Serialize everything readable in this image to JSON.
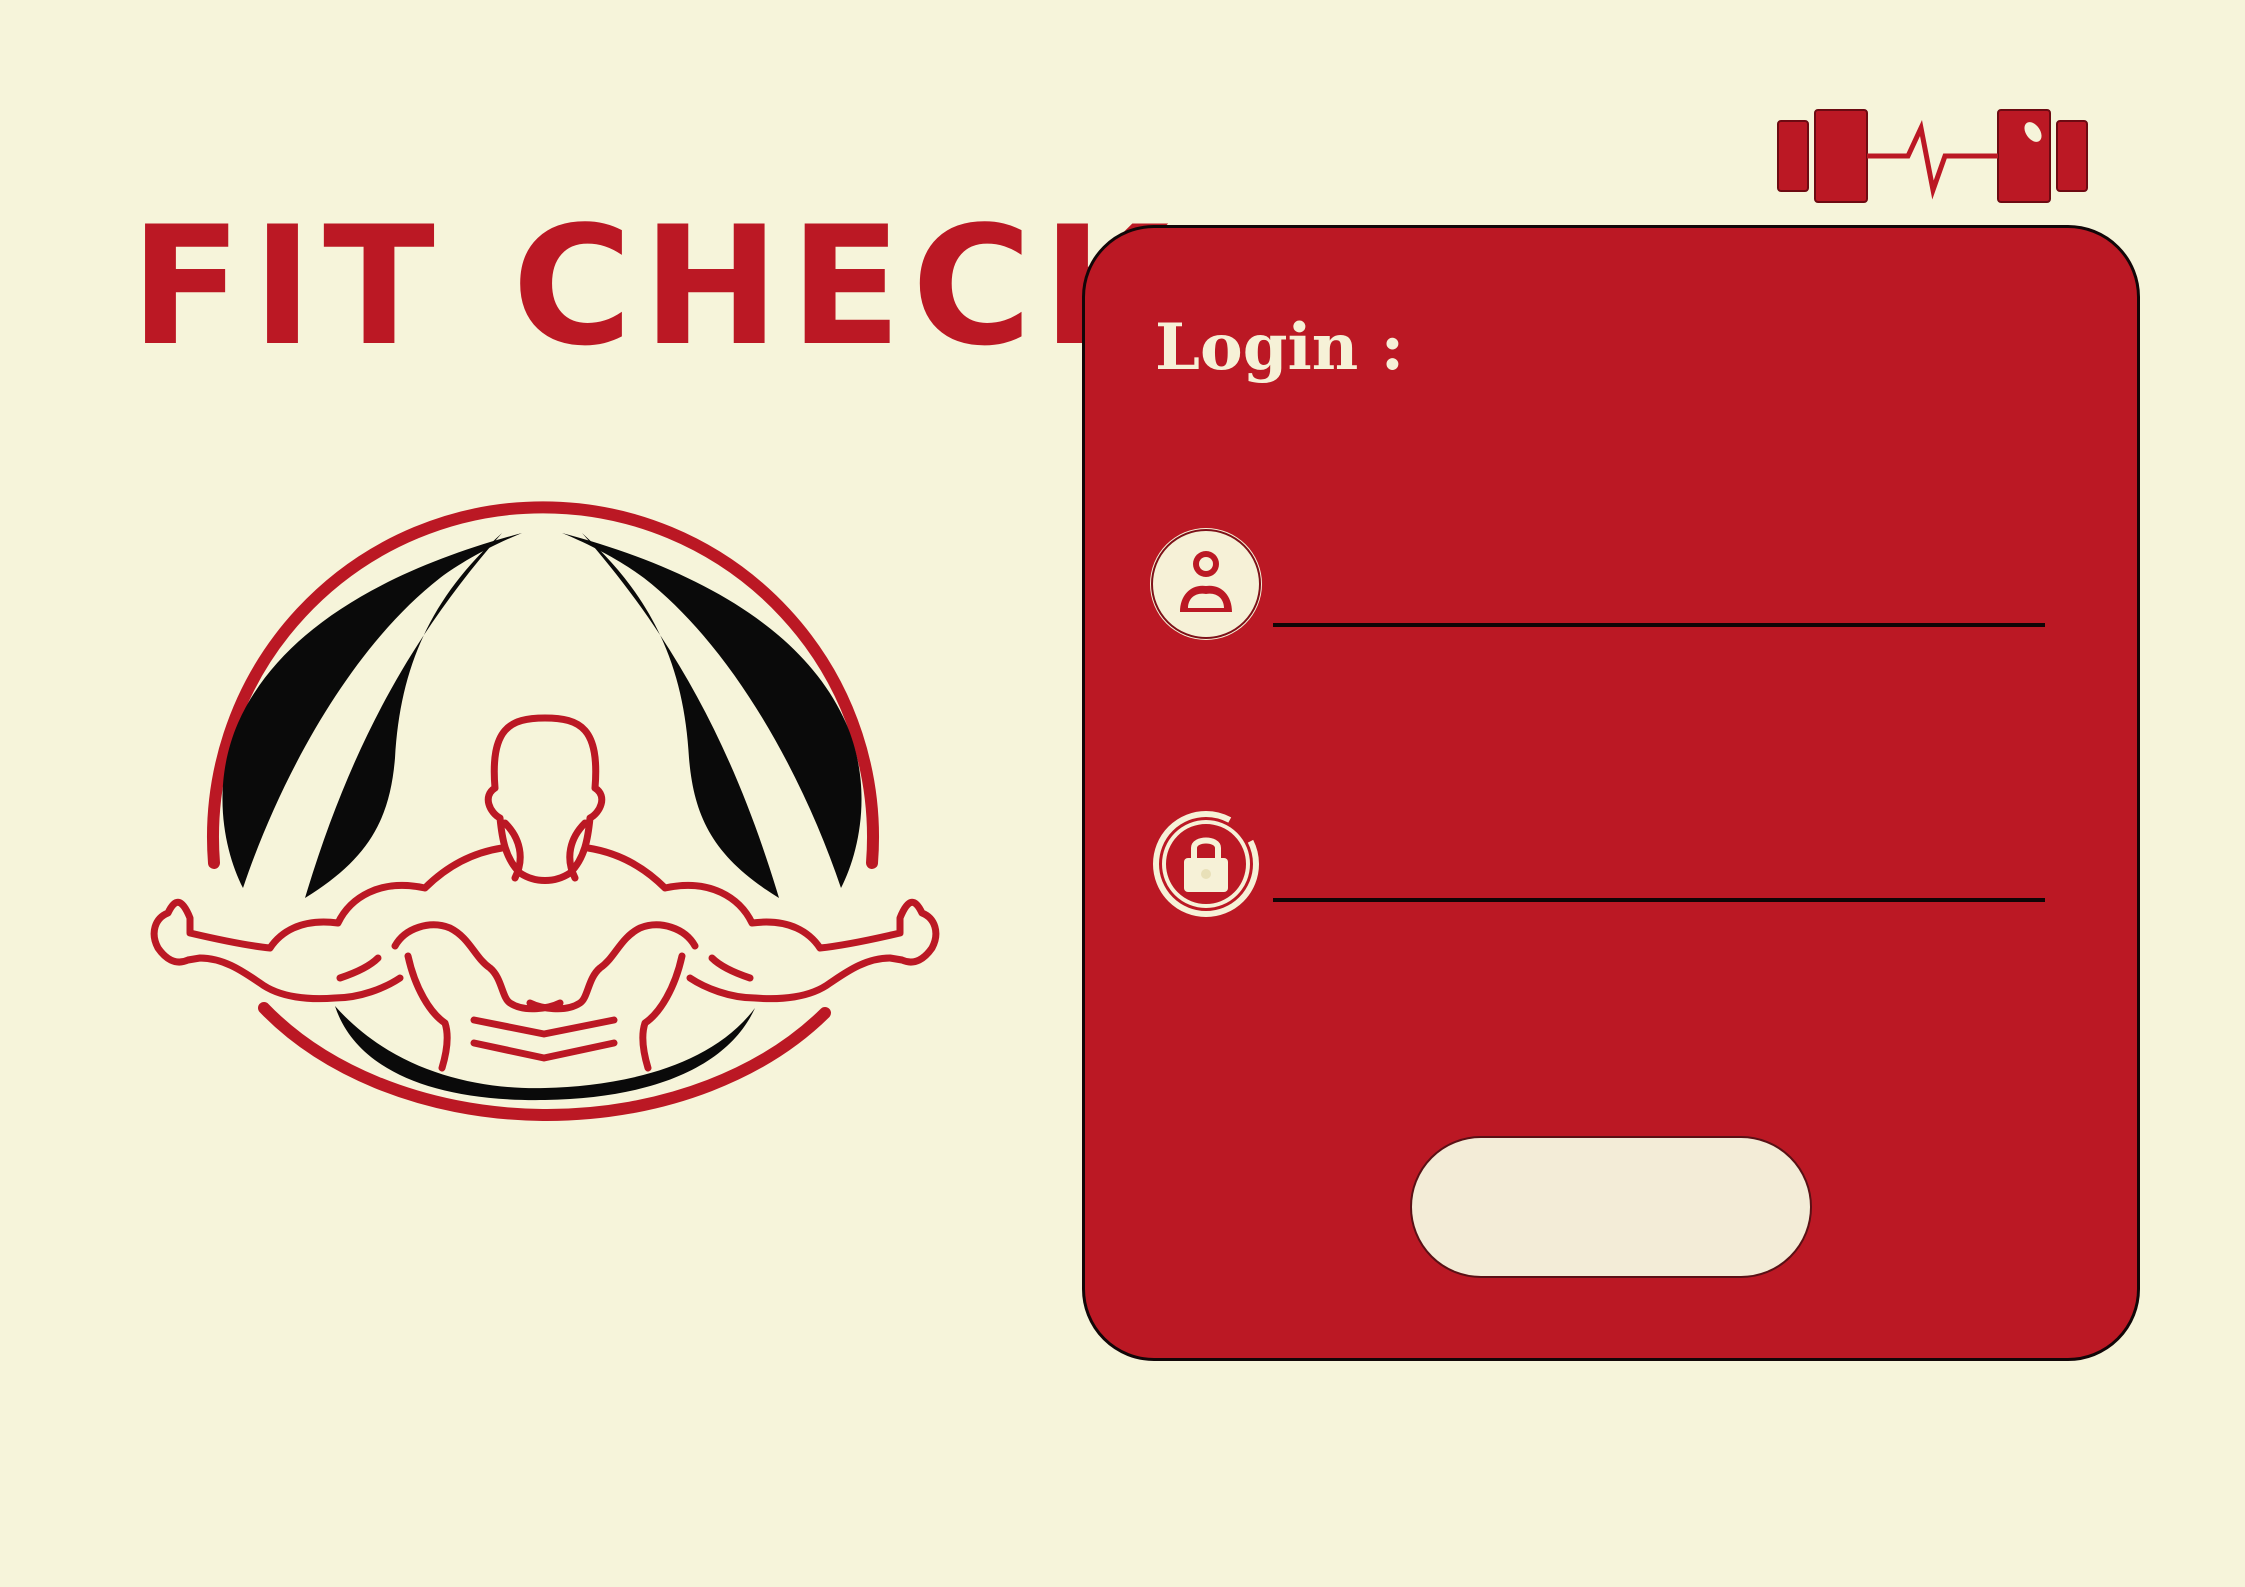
{
  "app": {
    "title": "FIT CHECK"
  },
  "header": {
    "logo_icon": "dumbbell-heartbeat-icon"
  },
  "emblem": {
    "icon": "muscleman-laurel-emblem"
  },
  "login_panel": {
    "label": "Login :",
    "username": {
      "icon": "user-icon",
      "value": "",
      "placeholder": ""
    },
    "password": {
      "icon": "lock-icon",
      "value": "",
      "placeholder": ""
    },
    "submit_label": ""
  },
  "colors": {
    "background": "#f6f4da",
    "brand_red": "#bb1824",
    "cream": "#f6f1d7",
    "line": "#0f0506"
  }
}
